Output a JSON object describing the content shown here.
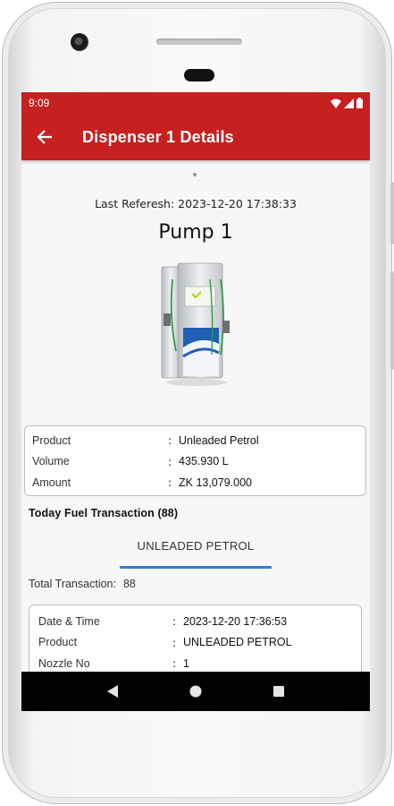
{
  "status_bar": {
    "time": "9:09"
  },
  "app_bar": {
    "title": "Dispenser 1 Details"
  },
  "refresh": {
    "label": "Last Referesh:",
    "value": "2023-12-20 17:38:33"
  },
  "pump": {
    "title": "Pump 1"
  },
  "summary": {
    "rows": [
      {
        "label": "Product",
        "sep": ":",
        "value": "Unleaded Petrol"
      },
      {
        "label": "Volume",
        "sep": ":",
        "value": "435.930 L"
      },
      {
        "label": "Amount",
        "sep": ":",
        "value": "ZK 13,079.000"
      }
    ]
  },
  "today": {
    "label": "Today Fuel Transaction (88)"
  },
  "tab": {
    "label": "UNLEADED PETROL"
  },
  "total": {
    "label": "Total Transaction:",
    "count": "88"
  },
  "transaction": {
    "rows": [
      {
        "label": "Date & Time",
        "sep": ":",
        "value": "2023-12-20 17:36:53"
      },
      {
        "label": "Product",
        "sep": ":",
        "value": "UNLEADED PETROL"
      },
      {
        "label": "Nozzle No",
        "sep": ":",
        "value": "1"
      }
    ]
  },
  "colors": {
    "app_bar": "#c62020",
    "tab_indicator": "#2f7fd8",
    "nav_bar": "#000000"
  },
  "icons": [
    "wifi-icon",
    "cell-signal-icon",
    "battery-icon",
    "back-arrow-icon",
    "nav-back-icon",
    "nav-home-icon",
    "nav-recents-icon"
  ]
}
